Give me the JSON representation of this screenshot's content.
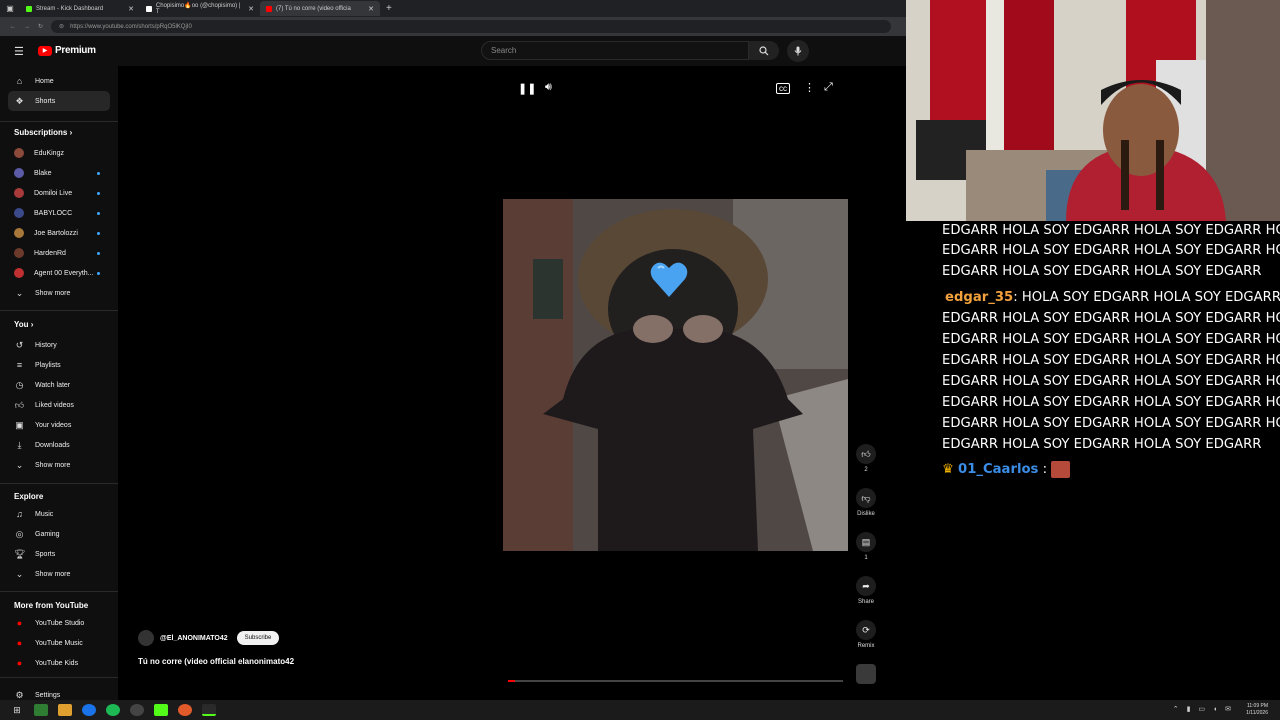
{
  "browser": {
    "tabs": [
      {
        "title": "Stream - Kick Dashboard",
        "color": "#53fc18"
      },
      {
        "title": "Chopisimo🔥oo (@chopisimo) | T",
        "color": "#ffffff"
      },
      {
        "title": "(7) Tú no corre (video officia",
        "color": "#ff0000"
      }
    ],
    "url": "https://www.youtube.com/shorts/pRqO5lKQjI0"
  },
  "header": {
    "logo_text": "Premium",
    "search_placeholder": "Search"
  },
  "sidebar": {
    "top": [
      {
        "label": "Home",
        "icon": "home-icon"
      },
      {
        "label": "Shorts",
        "icon": "shorts-icon"
      }
    ],
    "subscriptions_title": "Subscriptions",
    "subscriptions": [
      {
        "label": "EduKingz",
        "color": "#8b4a3a"
      },
      {
        "label": "Blake",
        "color": "#5b5ba8"
      },
      {
        "label": "Domiloi Live",
        "color": "#a83a3a"
      },
      {
        "label": "BABYLOCC",
        "color": "#3a4a8b"
      },
      {
        "label": "Joe Bartolozzi",
        "color": "#a8783a"
      },
      {
        "label": "HardenRd",
        "color": "#6b3a2a"
      },
      {
        "label": "Agent 00 Everyth...",
        "color": "#c03030"
      }
    ],
    "show_more": "Show more",
    "you_title": "You",
    "you_items": [
      {
        "label": "History"
      },
      {
        "label": "Playlists"
      },
      {
        "label": "Watch later"
      },
      {
        "label": "Liked videos"
      },
      {
        "label": "Your videos"
      },
      {
        "label": "Downloads"
      }
    ],
    "explore_title": "Explore",
    "explore_items": [
      {
        "label": "Music"
      },
      {
        "label": "Gaming"
      },
      {
        "label": "Sports"
      }
    ],
    "more_title": "More from YouTube",
    "more_items": [
      {
        "label": "YouTube Studio"
      },
      {
        "label": "YouTube Music"
      },
      {
        "label": "YouTube Kids"
      }
    ],
    "settings": "Settings"
  },
  "short": {
    "channel": "@El_ANONIMATO42",
    "subscribe": "Subscribe",
    "title": "Tú no corre (video official elanonimato42",
    "likes": "2",
    "dislike_label": "Dislike",
    "comments": "1",
    "share_label": "Share",
    "remix_label": "Remix",
    "progress_fraction": 0.02
  },
  "taskbar": {
    "time": "11:09 PM",
    "date": "1/11/2026"
  },
  "chat": {
    "lines": [
      "EDGARR HOLA SOY EDGARR HOLA SOY EDGARR HOLA",
      "EDGARR HOLA SOY EDGARR HOLA SOY EDGARR HOLA",
      "EDGARR HOLA SOY EDGARR HOLA SOY EDGARR"
    ],
    "user1": "edgar_35",
    "user1_first": ": HOLA SOY EDGARR HOLA SOY EDGARR H",
    "user1_lines": [
      "EDGARR HOLA SOY EDGARR HOLA SOY EDGARR HOLA",
      "EDGARR HOLA SOY EDGARR HOLA SOY EDGARR HOLA",
      "EDGARR HOLA SOY EDGARR HOLA SOY EDGARR HOLA",
      "EDGARR HOLA SOY EDGARR HOLA SOY EDGARR HOLA",
      "EDGARR HOLA SOY EDGARR HOLA SOY EDGARR HOLA",
      "EDGARR HOLA SOY EDGARR HOLA SOY EDGARR HOLA",
      "EDGARR HOLA SOY EDGARR HOLA SOY EDGARR"
    ],
    "user2": "01_Caarlos",
    "user2_sep": ":"
  }
}
